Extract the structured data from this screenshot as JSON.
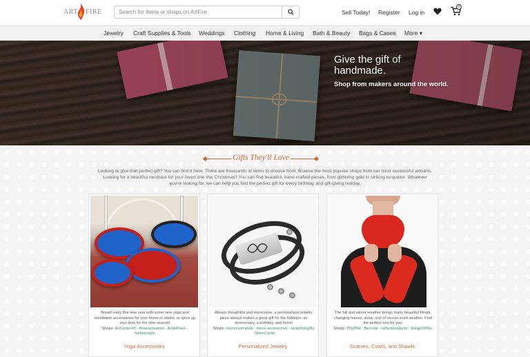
{
  "header": {
    "logo_left": "ART",
    "logo_right": "FIRE",
    "search_placeholder": "Search for items or shops on ArtFire",
    "sell_label": "Sell Today!",
    "register_label": "Register",
    "login_label": "Log in",
    "cart_count": "0"
  },
  "catnav": {
    "items": [
      "Jewelry",
      "Craft Supplies & Tools",
      "Weddings",
      "Clothing",
      "Home & Living",
      "Bath & Beauty",
      "Bags & Cases",
      "More ▾"
    ]
  },
  "hero": {
    "heading": "Give the gift of handmade.",
    "subheading": "Shop from makers around the world."
  },
  "gifts": {
    "title": "Gifts They'll Love",
    "intro": "Looking to give that perfect gift? You can find it here. There are thousands of items to choose from. Browse the most popular shops from our most successful artisans. Looking for a beautiful necklace for your loved one this Christmas? You can find beautiful, hand-crafted pieces, from glittering gold to striking turquoise. Whatever you're looking for, we can help you find the perfect gift for every birthday and gift-giving holiday.",
    "cards": [
      {
        "description": "Breath easy this new year with some new yoga and meditation accessories for your home or studio, or spice up your look for the new season!",
        "shops_label": "Shops:",
        "shops": "ArtCenter43 - Ruanacreation - ArtdeFleur - fashionstyle",
        "title": "Yoga Accessories"
      },
      {
        "description": "Always thoughtful and impressive, a personalized jewelry piece always makes a great gift for the holidays, an anniversary, a birthday, and more!",
        "shops_label": "Shops:",
        "shops": "mommysmetalz - mens-accessories - luckyhorsgifts - SilverCartel",
        "title": "Personalized Jewelry"
      },
      {
        "description": "The fall and winter weather brings many beautiful things, changing leaves, snow, and of course scarf weather. Find the perfect one for you.",
        "shops_label": "Shops:",
        "shops": "PhylPhil - Berniole - reflectionsbyds - WingsOfWin",
        "title": "Scarves, Cowls, and Shawls"
      }
    ]
  },
  "colors": {
    "accent": "#c8693a",
    "link": "#3a8a7a",
    "nav_bg": "#f2f2f2"
  },
  "icons": [
    "search-icon",
    "heart-icon",
    "cart-icon",
    "flame-logo-icon"
  ]
}
